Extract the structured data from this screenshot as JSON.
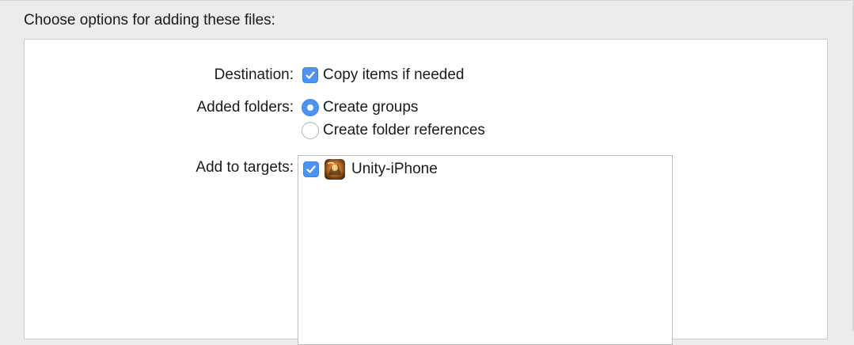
{
  "dialog": {
    "title": "Choose options for adding these files:"
  },
  "destination": {
    "label": "Destination:",
    "checkbox_label": "Copy items if needed",
    "checked": true
  },
  "added_folders": {
    "label": "Added folders:",
    "options": [
      {
        "label": "Create groups",
        "selected": true
      },
      {
        "label": "Create folder references",
        "selected": false
      }
    ]
  },
  "targets": {
    "label": "Add to targets:",
    "items": [
      {
        "name": "Unity-iPhone",
        "checked": true,
        "icon": "unity-app-icon"
      }
    ]
  },
  "colors": {
    "accent": "#4f93f0",
    "window_bg": "#ececec",
    "panel_bg": "#ffffff"
  }
}
